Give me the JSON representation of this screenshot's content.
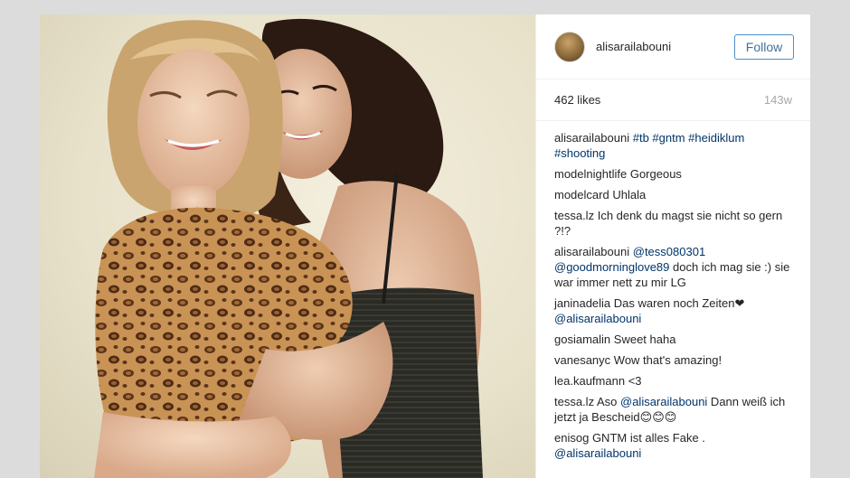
{
  "post": {
    "username": "alisarailabouni",
    "follow_label": "Follow",
    "likes": "462 likes",
    "age": "143w"
  },
  "comments": [
    {
      "user": "alisarailabouni",
      "segments": [
        {
          "t": "#tb #gntm #heidiklum #shooting",
          "link": true
        }
      ]
    },
    {
      "user": "modelnightlife",
      "segments": [
        {
          "t": "Gorgeous",
          "link": false
        }
      ]
    },
    {
      "user": "modelcard",
      "segments": [
        {
          "t": "Uhlala",
          "link": false
        }
      ]
    },
    {
      "user": "tessa.lz",
      "segments": [
        {
          "t": "Ich denk du magst sie nicht so gern ?!?",
          "link": false
        }
      ]
    },
    {
      "user": "alisarailabouni",
      "segments": [
        {
          "t": "@tess080301 @goodmorninglove89",
          "link": true
        },
        {
          "t": " doch ich mag sie :) sie war immer nett zu mir LG",
          "link": false
        }
      ]
    },
    {
      "user": "janinadelia",
      "segments": [
        {
          "t": "Das waren noch Zeiten❤ ",
          "link": false
        },
        {
          "t": "@alisarailabouni",
          "link": true
        }
      ]
    },
    {
      "user": "gosiamalin",
      "segments": [
        {
          "t": "Sweet haha",
          "link": false
        }
      ]
    },
    {
      "user": "vanesanyc",
      "segments": [
        {
          "t": "Wow that's amazing!",
          "link": false
        }
      ]
    },
    {
      "user": "lea.kaufmann",
      "segments": [
        {
          "t": "<3",
          "link": false
        }
      ]
    },
    {
      "user": "tessa.lz",
      "segments": [
        {
          "t": "Aso ",
          "link": false
        },
        {
          "t": "@alisarailabouni",
          "link": true
        },
        {
          "t": " Dann weiß ich jetzt ja Bescheid😊😊😊",
          "link": false
        }
      ]
    },
    {
      "user": "enisog",
      "segments": [
        {
          "t": "GNTM ist alles Fake . ",
          "link": false
        },
        {
          "t": "@alisarailabouni",
          "link": true
        }
      ]
    }
  ],
  "colors": {
    "link": "#003569",
    "follow_border": "#4a90c8",
    "text": "#262626",
    "muted": "#a5a7aa"
  }
}
